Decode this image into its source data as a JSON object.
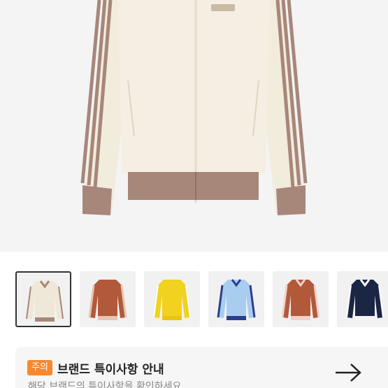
{
  "product": {
    "main_image": {
      "alt_icon": "jacket-main-image",
      "color_body": "#f4efe2",
      "color_trim": "#a7877a"
    }
  },
  "gallery": {
    "thumbnails": [
      {
        "name": "thumb-cream-brown",
        "body": "#efe8d8",
        "stripe": "#a7877a",
        "selected": true
      },
      {
        "name": "thumb-brown-pink",
        "body": "#b2593a",
        "stripe": "#e8c5b5",
        "selected": false
      },
      {
        "name": "thumb-yellow",
        "body": "#f1d21e",
        "stripe": "#ffffff",
        "selected": false
      },
      {
        "name": "thumb-light-blue",
        "body": "#a9cdf0",
        "stripe": "#2a3f8a",
        "selected": false
      },
      {
        "name": "thumb-rust-pink",
        "body": "#b2593a",
        "stripe": "#f2d2c8",
        "selected": false
      },
      {
        "name": "thumb-navy",
        "body": "#1b2544",
        "stripe": "#ffffff",
        "selected": false
      }
    ]
  },
  "notice": {
    "badge": "주의",
    "title": "브랜드 특이사항 안내",
    "subtitle": "해당 브랜드의 특이사항을 확인하세요",
    "arrow_icon": "arrow-right-icon"
  },
  "colors": {
    "badge": "#f7882f"
  }
}
